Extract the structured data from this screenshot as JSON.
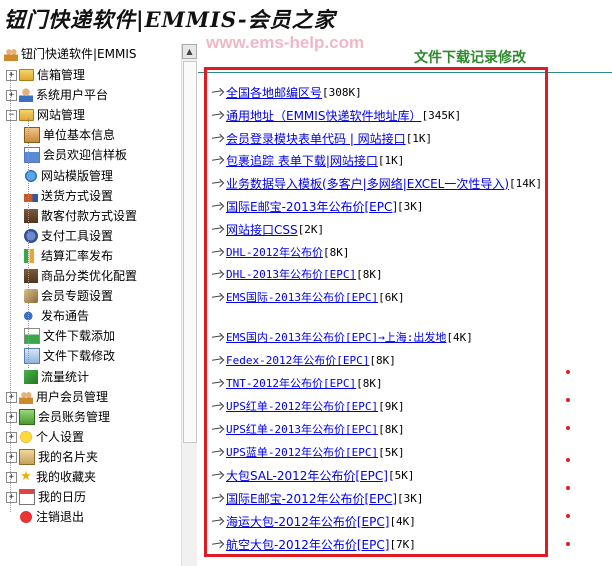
{
  "header": {
    "brand": "钮门快递软件|EMMIS-会员之家",
    "watermark": "www.ems-help.com",
    "page_title": "文件下载记录修改"
  },
  "sidebar": {
    "root_label": "钮门快递软件|EMMIS",
    "items": [
      {
        "label": "信箱管理",
        "icon": "folder-icon",
        "level": 1,
        "expander": "+"
      },
      {
        "label": "系统用户平台",
        "icon": "person-icon",
        "level": 1,
        "expander": "+"
      },
      {
        "label": "网站管理",
        "icon": "folder-icon",
        "level": 1,
        "expander": "−"
      },
      {
        "label": "单位基本信息",
        "icon": "shop-icon",
        "level": 2
      },
      {
        "label": "会员欢迎信样板",
        "icon": "card-icon",
        "level": 2
      },
      {
        "label": "网站模版管理",
        "icon": "globe-icon",
        "level": 2
      },
      {
        "label": "送货方式设置",
        "icon": "truck-icon",
        "level": 2
      },
      {
        "label": "散客付款方式设置",
        "icon": "box-icon",
        "level": 2
      },
      {
        "label": "支付工具设置",
        "icon": "shield-icon",
        "level": 2
      },
      {
        "label": "结算汇率发布",
        "icon": "chart-icon",
        "level": 2
      },
      {
        "label": "商品分类优化配置",
        "icon": "box-icon",
        "level": 2
      },
      {
        "label": "会员专题设置",
        "icon": "cards-icon",
        "level": 2
      },
      {
        "label": "发布通告",
        "icon": "speaker-icon",
        "level": 2
      },
      {
        "label": "文件下载添加",
        "icon": "download-icon",
        "level": 2
      },
      {
        "label": "文件下载修改",
        "icon": "modify-icon",
        "level": 2
      },
      {
        "label": "流量统计",
        "icon": "flow-icon",
        "level": 2
      },
      {
        "label": "用户会员管理",
        "icon": "people-icon",
        "level": 1,
        "expander": "+"
      },
      {
        "label": "会员账务管理",
        "icon": "money-icon",
        "level": 1,
        "expander": "+"
      },
      {
        "label": "个人设置",
        "icon": "smile-icon",
        "level": 1,
        "expander": "+"
      },
      {
        "label": "我的名片夹",
        "icon": "cardholder-icon",
        "level": 1,
        "expander": "+"
      },
      {
        "label": "我的收藏夹",
        "icon": "star-icon",
        "level": 1,
        "expander": "+"
      },
      {
        "label": "我的日历",
        "icon": "calendar-icon",
        "level": 1,
        "expander": "+"
      },
      {
        "label": "注销退出",
        "icon": "exit-icon",
        "level": 1
      }
    ]
  },
  "files": [
    {
      "name": "全国各地邮编区号",
      "size": "[308K]"
    },
    {
      "name": "通用地址（EMMIS快递软件地址库）",
      "size": "[345K]"
    },
    {
      "name": "会员登录模块表单代码 | 网站接口",
      "size": "[1K]"
    },
    {
      "name": "包裹追踪 表单下载|网站接口",
      "size": "[1K]"
    },
    {
      "name": "业务数据导入模板(多客户|多网络|EXCEL一次性导入)",
      "size": "[14K]"
    },
    {
      "name": "国际E邮宝-2013年公布价[EPC]",
      "size": "[3K]"
    },
    {
      "name": "网站接口CSS",
      "size": "[2K]"
    },
    {
      "name": "DHL-2012年公布价",
      "size": "[8K]"
    },
    {
      "name": "DHL-2013年公布价[EPC]",
      "size": "[8K]"
    },
    {
      "name": "EMS国际-2013年公布价[EPC]",
      "size": "[6K]"
    },
    {
      "name": "EMS国内-2013年公布价[EPC]→上海:出发地",
      "size": "[4K]"
    },
    {
      "name": "Fedex-2012年公布价[EPC]",
      "size": "[8K]"
    },
    {
      "name": "TNT-2012年公布价[EPC]",
      "size": "[8K]"
    },
    {
      "name": "UPS红单-2012年公布价[EPC]",
      "size": "[9K]"
    },
    {
      "name": "UPS红单-2013年公布价[EPC]",
      "size": "[8K]"
    },
    {
      "name": "UPS蓝单-2012年公布价[EPC]",
      "size": "[5K]"
    },
    {
      "name": "大包SAL-2012年公布价[EPC]",
      "size": "[5K]"
    },
    {
      "name": "国际E邮宝-2012年公布价[EPC]",
      "size": "[3K]"
    },
    {
      "name": "海运大包-2012年公布价[EPC]",
      "size": "[4K]"
    },
    {
      "name": "航空大包-2012年公布价[EPC]",
      "size": "[7K]"
    }
  ],
  "colors": {
    "highlight_border": "#e11b22",
    "link": "#0000ee",
    "title": "#2f8a2f"
  }
}
